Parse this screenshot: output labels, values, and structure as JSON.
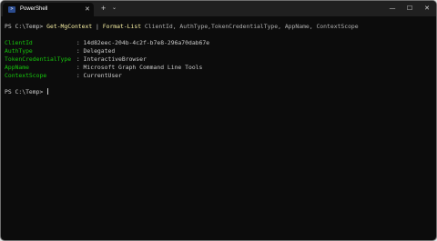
{
  "tab": {
    "title": "PowerShell",
    "icon": "powershell-icon",
    "close_glyph": "✕"
  },
  "tabstrip": {
    "new_tab_glyph": "+",
    "dropdown_glyph": "⌄"
  },
  "window_controls": {
    "minimize": "—",
    "maximize": "☐",
    "close": "✕"
  },
  "terminal": {
    "prompt": "PS C:\\Temp> ",
    "command": {
      "cmdlet": "Get-MgContext",
      "pipe": " | ",
      "format_cmdlet": "Format-List",
      "args": " ClientId, AuthType,TokenCredentialType, AppName, ContextScope"
    },
    "output": [
      {
        "field": "ClientId",
        "sep": " : ",
        "value": "14d82eec-204b-4c2f-b7e8-296a70dab67e"
      },
      {
        "field": "AuthType",
        "sep": " : ",
        "value": "Delegated"
      },
      {
        "field": "TokenCredentialType",
        "sep": " : ",
        "value": "InteractiveBrowser"
      },
      {
        "field": "AppName",
        "sep": " : ",
        "value": "Microsoft Graph Command Line Tools"
      },
      {
        "field": "ContextScope",
        "sep": " : ",
        "value": "CurrentUser"
      }
    ],
    "final_prompt": "PS C:\\Temp> "
  },
  "colors": {
    "background": "#0c0c0c",
    "text": "#cccccc",
    "command": "#f9f1a5",
    "field": "#16c60c",
    "titlebar": "#202020"
  }
}
